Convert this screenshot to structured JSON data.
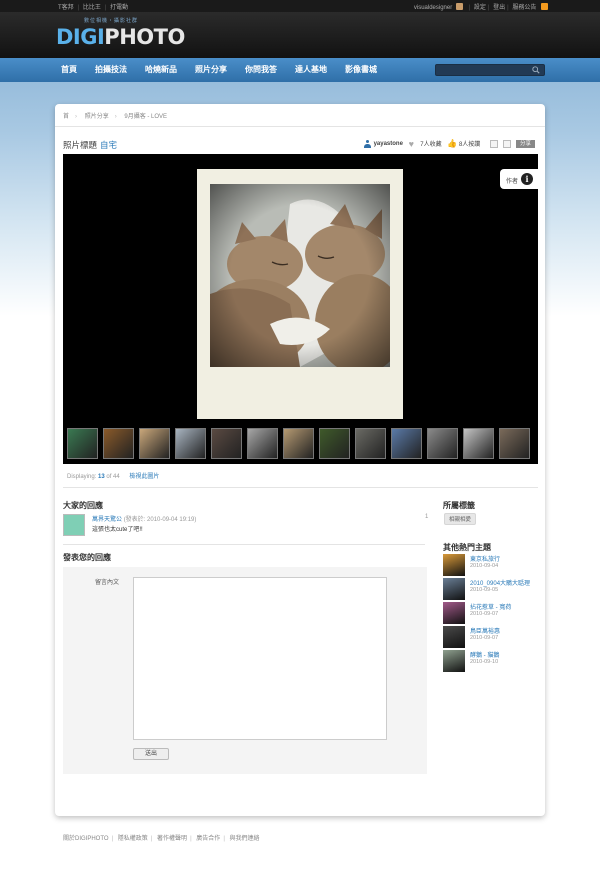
{
  "topbar": {
    "left_links": [
      "T客邦",
      "比比王",
      "打電動"
    ],
    "username": "visualdesigner",
    "settings": "設定",
    "logout": "登出",
    "service": "服務公告"
  },
  "header": {
    "logo_sub": "數位相機・攝影社群",
    "logo_digi": "DIGI",
    "logo_photo": "PHOTO"
  },
  "nav": {
    "items": [
      "首頁",
      "拍攝技法",
      "哈燒新品",
      "照片分享",
      "你問我答",
      "達人基地",
      "影像書城"
    ],
    "search_placeholder": ""
  },
  "breadcrumb": [
    "首",
    "照片分享",
    "9月攝客 - LOVE"
  ],
  "photo": {
    "title_label": "照片標題",
    "album": "自宅",
    "owner": "yayastone",
    "favorites": "7人收藏",
    "likes": "8人按讚",
    "share": "分享",
    "author_label": "作者"
  },
  "thumbnails": {
    "count": 13,
    "colors": [
      "#3a7a52",
      "#8a5a2a",
      "#c9a77a",
      "#a8b4c0",
      "#5a4a42",
      "#a7a7a7",
      "#b59a72",
      "#3f5a2a",
      "#6a6a64",
      "#5a7aa8",
      "#8a8a8a",
      "#c4c4c4",
      "#7a6a5a"
    ]
  },
  "displaying": {
    "prefix": "Displaying:",
    "from": "13",
    "total_text": "of 44",
    "browse_all": "檢視此圖片"
  },
  "comments": {
    "heading": "大家的回應",
    "items": [
      {
        "author": "萬界天驚公",
        "timestamp": "(發表於: 2010-09-04 19:19)",
        "text": "這張也太cute了吧!!",
        "num": "1"
      }
    ]
  },
  "reply": {
    "heading": "發表您的回應",
    "label": "留言內文",
    "submit": "送出"
  },
  "sidebar": {
    "tags_heading": "所屬標籤",
    "tags": [
      "相親相愛"
    ],
    "hot_heading": "其他熱門主題",
    "hot_items": [
      {
        "title": "東京私旅行",
        "date": "2010-09-04"
      },
      {
        "title": "2010_0904大鵰大聒理",
        "date": "2010-09-05"
      },
      {
        "title": "拈花惹草 - 寬荷",
        "date": "2010-09-07"
      },
      {
        "title": "鳥臣萬裕惠",
        "date": "2010-09-07"
      },
      {
        "title": "酵鵝 - 貓鵝",
        "date": "2010-09-10"
      }
    ]
  },
  "footer": {
    "links": [
      "關於DIGIPHOTO",
      "隱私權政策",
      "著作權聲明",
      "廣告合作",
      "與我們連絡"
    ]
  }
}
